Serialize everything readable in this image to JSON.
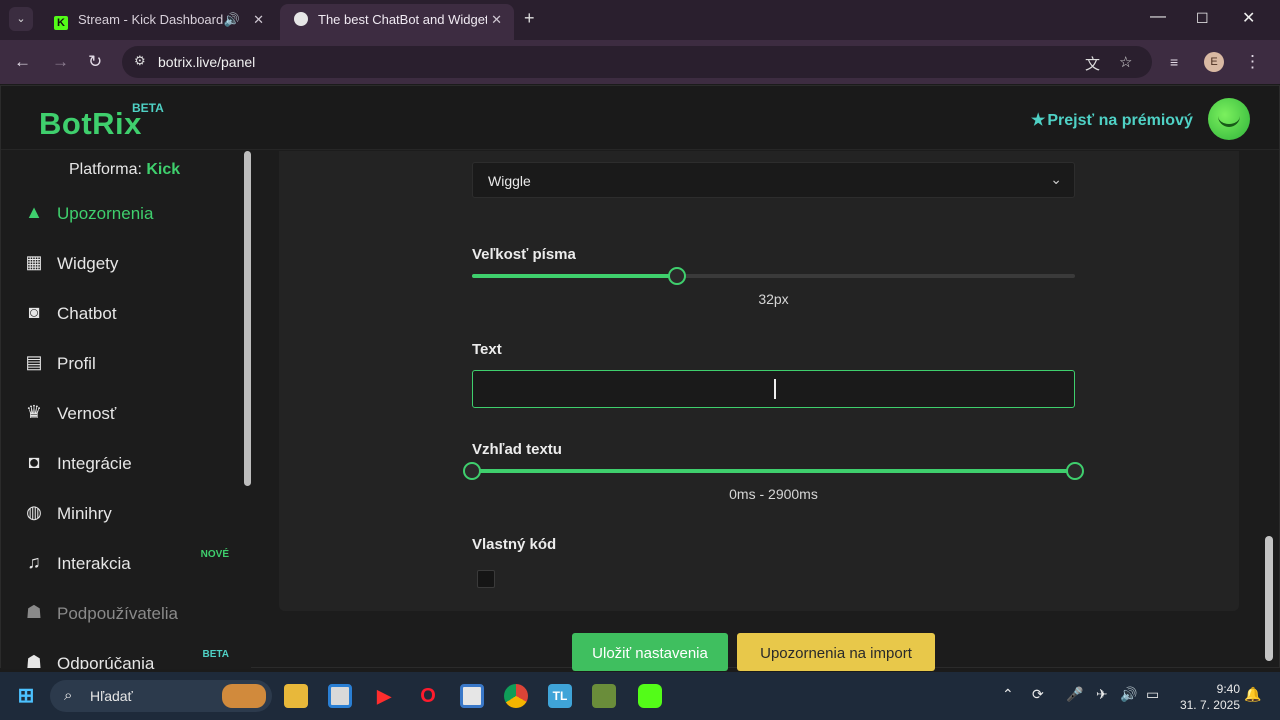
{
  "browser": {
    "tabs": [
      {
        "title": "Stream - Kick Dashboard",
        "favicon": "kick-icon"
      },
      {
        "title": "The best ChatBot and Widgets",
        "favicon": "botrix-icon"
      }
    ],
    "url": "botrix.live/panel",
    "profile_initial": "E"
  },
  "site": {
    "logo": "BotRix",
    "logo_badge": "BETA",
    "premium_label": "Prejsť na prémiový",
    "accent": "#3fcf6d"
  },
  "sidebar": {
    "platform_label": "Platforma:",
    "platform_value": "Kick",
    "items": [
      {
        "label": "Upozornenia",
        "icon": "warning-icon",
        "state": "active"
      },
      {
        "label": "Widgety",
        "icon": "grid-icon"
      },
      {
        "label": "Chatbot",
        "icon": "robot-icon"
      },
      {
        "label": "Profil",
        "icon": "id-card-icon"
      },
      {
        "label": "Vernosť",
        "icon": "trophy-icon"
      },
      {
        "label": "Integrácie",
        "icon": "discord-icon"
      },
      {
        "label": "Minihry",
        "icon": "gamepad-icon"
      },
      {
        "label": "Interakcia",
        "icon": "music-icon",
        "badge": "NOVÉ"
      },
      {
        "label": "Podpoužívatelia",
        "icon": "users-icon",
        "state": "disabled"
      },
      {
        "label": "Odporúčania",
        "icon": "users-icon",
        "badge": "BETA"
      }
    ]
  },
  "form": {
    "animation_value": "Wiggle",
    "font_size_label": "Veľkosť písma",
    "font_size_value": "32px",
    "font_size_fraction": 0.34,
    "text_label": "Text",
    "text_value": "",
    "appearance_label": "Vzhľad textu",
    "appearance_value": "0ms - 2900ms",
    "appearance_range": [
      0,
      1
    ],
    "custom_code_label": "Vlastný kód",
    "custom_code_checked": false,
    "save_button": "Uložiť nastavenia",
    "import_button": "Upozornenia na import"
  },
  "taskbar": {
    "search_placeholder": "Hľadať",
    "time": "9:40",
    "date": "31. 7. 2025"
  }
}
